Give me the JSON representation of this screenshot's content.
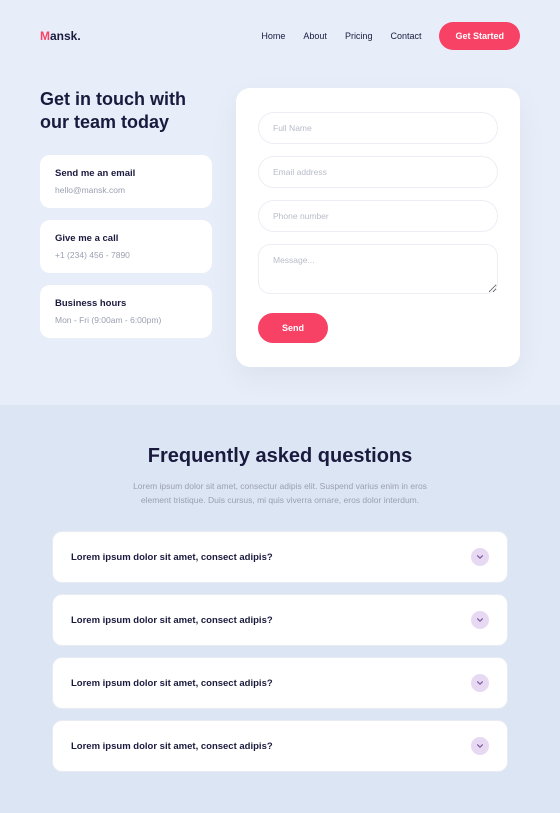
{
  "brand": {
    "name": "Mansk."
  },
  "nav": {
    "home": "Home",
    "about": "About",
    "pricing": "Pricing",
    "contact": "Contact",
    "cta": "Get Started"
  },
  "contact": {
    "title": "Get in touch with our team today",
    "cards": [
      {
        "title": "Send me an email",
        "text": "hello@mansk.com"
      },
      {
        "title": "Give me a call",
        "text": "+1 (234) 456 - 7890"
      },
      {
        "title": "Business hours",
        "text": "Mon - Fri (9:00am - 6:00pm)"
      }
    ],
    "form": {
      "name": "Full Name",
      "email": "Email address",
      "phone": "Phone number",
      "message": "Message...",
      "send": "Send"
    }
  },
  "faq": {
    "title": "Frequently asked questions",
    "desc": "Lorem ipsum dolor sit amet, consectur adipis elit. Suspend varius enim in eros element tristique. Duis cursus, mi quis viverra ornare, eros dolor interdum.",
    "items": [
      {
        "q": "Lorem ipsum dolor sit amet, consect adipis?"
      },
      {
        "q": "Lorem ipsum dolor sit amet, consect adipis?"
      },
      {
        "q": "Lorem ipsum dolor sit amet, consect adipis?"
      },
      {
        "q": "Lorem ipsum dolor sit amet, consect adipis?"
      }
    ]
  }
}
